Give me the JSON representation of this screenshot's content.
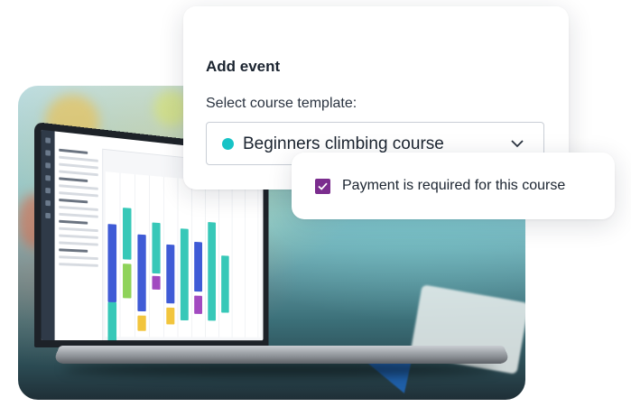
{
  "add_event_card": {
    "title": "Add event",
    "template_label": "Select course template:",
    "selected_template": "Beginners climbing course",
    "selected_template_dot_color": "#17c3c6",
    "dropdown_icon": "chevron-down-icon"
  },
  "payment_card": {
    "checkbox_checked": true,
    "checkbox_color": "#7b2d8e",
    "label": "Payment is required for this course"
  },
  "colors": {
    "accent_teal": "#17c3c6",
    "accent_purple": "#7b2d8e",
    "text_dark": "#1b2430"
  }
}
